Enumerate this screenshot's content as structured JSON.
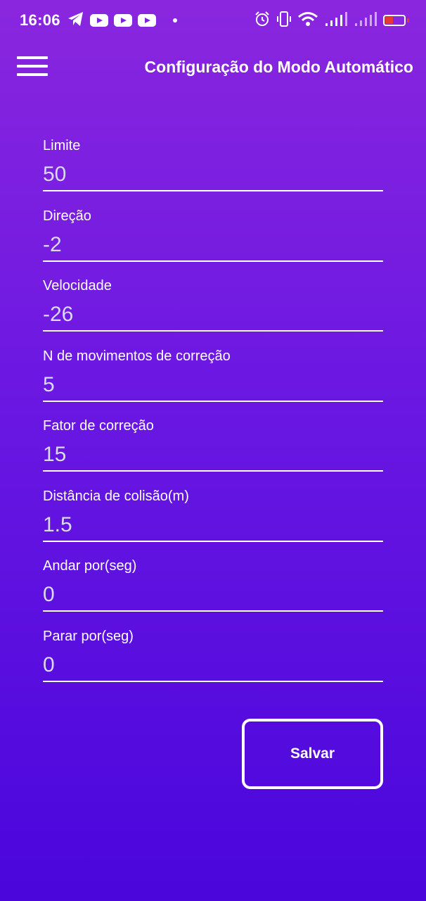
{
  "status_bar": {
    "time": "16:06",
    "left_icons": [
      "telegram-icon",
      "youtube-icon",
      "youtube-icon",
      "youtube-icon",
      "notification-dot-icon"
    ],
    "right_icons": [
      "alarm-icon",
      "vibrate-icon",
      "wifi-icon",
      "signal-icon",
      "signal-icon",
      "battery-icon"
    ],
    "battery_level": "11",
    "battery_color": "#e53935"
  },
  "header": {
    "menu_icon": "hamburger-menu-icon",
    "title": "Configuração do Modo Automático"
  },
  "form": {
    "fields": [
      {
        "label": "Limite",
        "value": "50"
      },
      {
        "label": "Direção",
        "value": "-2"
      },
      {
        "label": "Velocidade",
        "value": "-26"
      },
      {
        "label": "N de movimentos de correção",
        "value": "5"
      },
      {
        "label": "Fator de correção",
        "value": "15"
      },
      {
        "label": "Distância de colisão(m)",
        "value": "1.5"
      },
      {
        "label": "Andar por(seg)",
        "value": "0"
      },
      {
        "label": "Parar por(seg)",
        "value": "0"
      }
    ]
  },
  "actions": {
    "save_label": "Salvar"
  },
  "colors": {
    "gradient_top": "#8a26de",
    "gradient_bottom": "#4a06dc",
    "text": "#ffffff",
    "input_value": "#d9d9ef"
  }
}
